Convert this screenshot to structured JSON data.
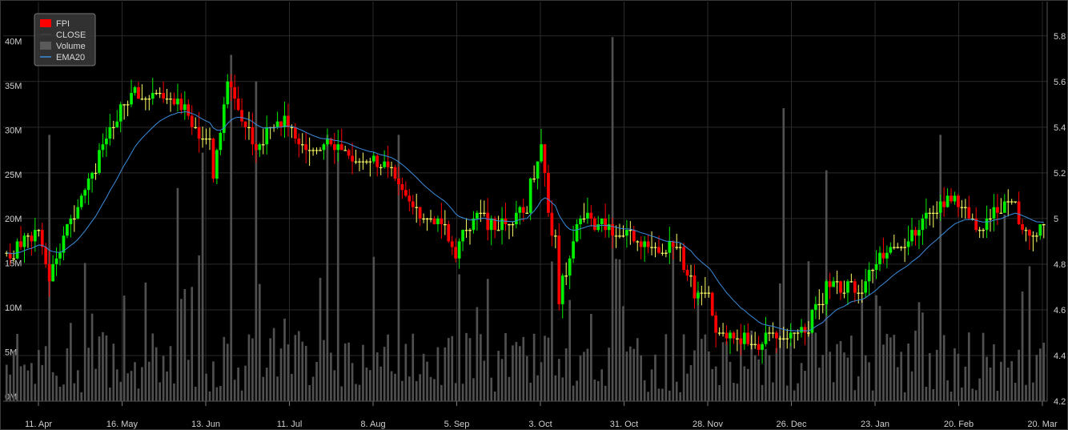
{
  "chart_data": {
    "type": "candlestick",
    "title": "",
    "legend": {
      "placement": "top-left",
      "entries": [
        {
          "name": "FPI",
          "color": "#ff0000",
          "kind": "box"
        },
        {
          "name": "CLOSE",
          "color": "#404040",
          "kind": "line"
        },
        {
          "name": "Volume",
          "color": "#5a5a5a",
          "kind": "box"
        },
        {
          "name": "EMA20",
          "color": "#3a8dde",
          "kind": "line"
        }
      ]
    },
    "colors": {
      "up": "#00ee00",
      "down": "#ff0000",
      "flat": "#ffff66",
      "volume": "#505050",
      "ema": "#3a8dde",
      "grid": "#2a2a2a"
    },
    "x_ticks": [
      "11. Apr",
      "16. May",
      "13. Jun",
      "11. Jul",
      "8. Aug",
      "5. Sep",
      "3. Oct",
      "31. Oct",
      "28. Nov",
      "26. Dec",
      "23. Jan",
      "20. Feb",
      "20. Mar"
    ],
    "price_axis": {
      "side": "right",
      "min": 4.2,
      "max": 5.95,
      "ticks": [
        "4.2",
        "4.4",
        "4.6",
        "4.8",
        "5",
        "5.2",
        "5.4",
        "5.6",
        "5.8"
      ]
    },
    "volume_axis": {
      "side": "left",
      "min": 0,
      "max": 45,
      "ticks": [
        "0M",
        "5M",
        "10M",
        "15M",
        "20M",
        "25M",
        "30M",
        "35M",
        "40M"
      ]
    },
    "price_knots": [
      [
        0,
        4.85
      ],
      [
        8,
        4.95
      ],
      [
        12,
        4.75
      ],
      [
        18,
        5.0
      ],
      [
        28,
        5.35
      ],
      [
        35,
        5.55
      ],
      [
        50,
        5.5
      ],
      [
        58,
        5.2
      ],
      [
        62,
        5.6
      ],
      [
        70,
        5.3
      ],
      [
        76,
        5.45
      ],
      [
        85,
        5.3
      ],
      [
        90,
        5.35
      ],
      [
        95,
        5.28
      ],
      [
        105,
        5.25
      ],
      [
        112,
        5.1
      ],
      [
        122,
        4.95
      ],
      [
        126,
        4.85
      ],
      [
        130,
        5.0
      ],
      [
        140,
        4.98
      ],
      [
        145,
        5.05
      ],
      [
        150,
        5.3
      ],
      [
        155,
        4.65
      ],
      [
        160,
        5.0
      ],
      [
        170,
        4.95
      ],
      [
        180,
        4.9
      ],
      [
        188,
        4.85
      ],
      [
        195,
        4.62
      ],
      [
        200,
        4.5
      ],
      [
        210,
        4.45
      ],
      [
        220,
        4.5
      ],
      [
        225,
        4.55
      ],
      [
        230,
        4.7
      ],
      [
        238,
        4.7
      ],
      [
        245,
        4.82
      ],
      [
        252,
        4.88
      ],
      [
        258,
        5.0
      ],
      [
        265,
        5.1
      ],
      [
        272,
        4.98
      ],
      [
        280,
        5.05
      ],
      [
        288,
        4.92
      ],
      [
        291,
        5.03
      ]
    ],
    "volume_spikes": {
      "12": 30,
      "48": 24,
      "55": 28,
      "63": 39,
      "70": 36,
      "90": 30,
      "93": 28,
      "110": 30,
      "170": 41,
      "218": 33,
      "230": 26,
      "262": 30,
      "280": 21
    },
    "ema_period": 20
  }
}
